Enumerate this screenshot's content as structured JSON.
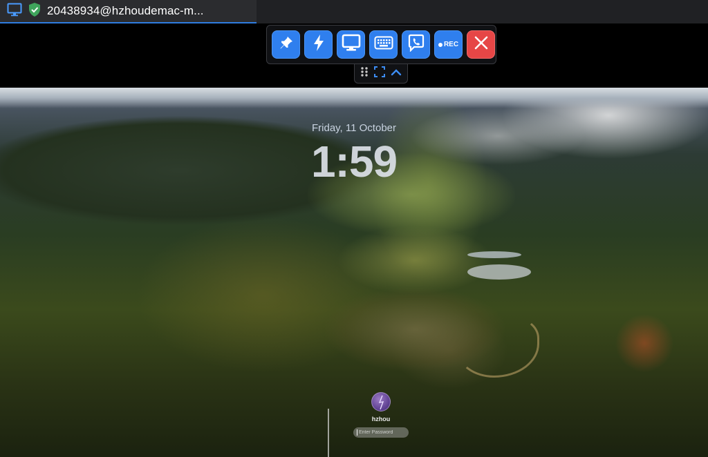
{
  "tab": {
    "title": "20438934@hzhoudemac-m...",
    "icons": [
      "monitor-icon",
      "shield-check-icon"
    ]
  },
  "toolbar": {
    "buttons": [
      {
        "icon": "pin-icon"
      },
      {
        "icon": "lightning-icon"
      },
      {
        "icon": "display-icon"
      },
      {
        "icon": "keyboard-icon"
      },
      {
        "icon": "chat-phone-icon"
      },
      {
        "icon": "record-icon",
        "label": "REC"
      },
      {
        "icon": "close-icon"
      }
    ],
    "sub": [
      "grip-icon",
      "fullscreen-icon",
      "chevron-up-icon"
    ]
  },
  "lock": {
    "date": "Friday, 11 October",
    "time": "1:59",
    "user": "hzhou",
    "password_placeholder": "Enter Password"
  },
  "colors": {
    "accent": "#2f7fee",
    "close": "#e64646",
    "tab_bg": "#2b2c2f",
    "tab_underline": "#2f7de1"
  }
}
